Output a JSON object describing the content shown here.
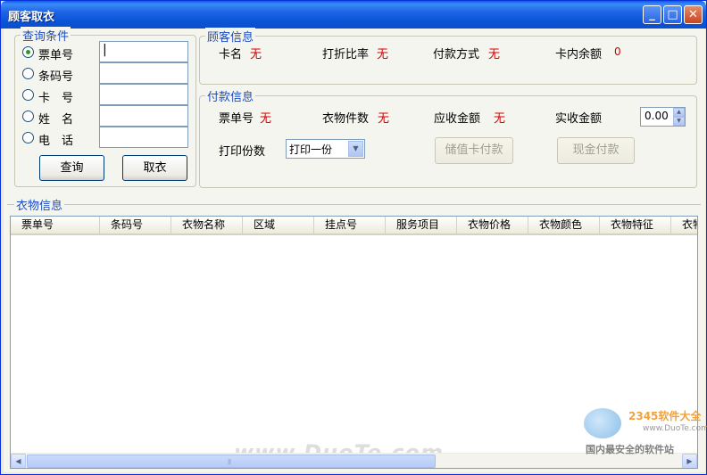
{
  "window": {
    "title": "顾客取衣",
    "buttons": {
      "minimize": "_",
      "maximize": "□",
      "close": "✕"
    }
  },
  "query": {
    "legend": "查询条件",
    "options": [
      {
        "label": "票单号",
        "checked": true,
        "value": "|"
      },
      {
        "label": "条码号",
        "checked": false,
        "value": ""
      },
      {
        "label": "卡　号",
        "checked": false,
        "value": ""
      },
      {
        "label": "姓　名",
        "checked": false,
        "value": ""
      },
      {
        "label": "电　话",
        "checked": false,
        "value": ""
      }
    ],
    "search_button": "查询",
    "pickup_button": "取衣"
  },
  "customer": {
    "legend": "顾客信息",
    "card_name_label": "卡名",
    "card_name_value": "无",
    "discount_label": "打折比率",
    "discount_value": "无",
    "payment_method_label": "付款方式",
    "payment_method_value": "无",
    "balance_label": "卡内余额",
    "balance_value": "0"
  },
  "payment": {
    "legend": "付款信息",
    "ticket_label": "票单号",
    "ticket_value": "无",
    "count_label": "衣物件数",
    "count_value": "无",
    "due_label": "应收金额",
    "due_value": "无",
    "received_label": "实收金额",
    "received_value": "0.00",
    "copies_label": "打印份数",
    "copies_selected": "打印一份",
    "stored_card_button": "储值卡付款",
    "cash_button": "现金付款"
  },
  "clothes": {
    "legend": "衣物信息",
    "columns": [
      "票单号",
      "条码号",
      "衣物名称",
      "区域",
      "挂点号",
      "服务项目",
      "衣物价格",
      "衣物颜色",
      "衣物特征",
      "衣物"
    ],
    "rows": []
  },
  "watermark": {
    "main": "www.DuoTe.com",
    "brand": "2345软件大全",
    "url": "www.DuoTe.com",
    "slogan": "国内最安全的软件站"
  },
  "colors": {
    "title_blue": "#0A54D6",
    "legend_blue": "#1C4DBE",
    "value_red": "#D70000",
    "radio_green": "#21A121"
  }
}
